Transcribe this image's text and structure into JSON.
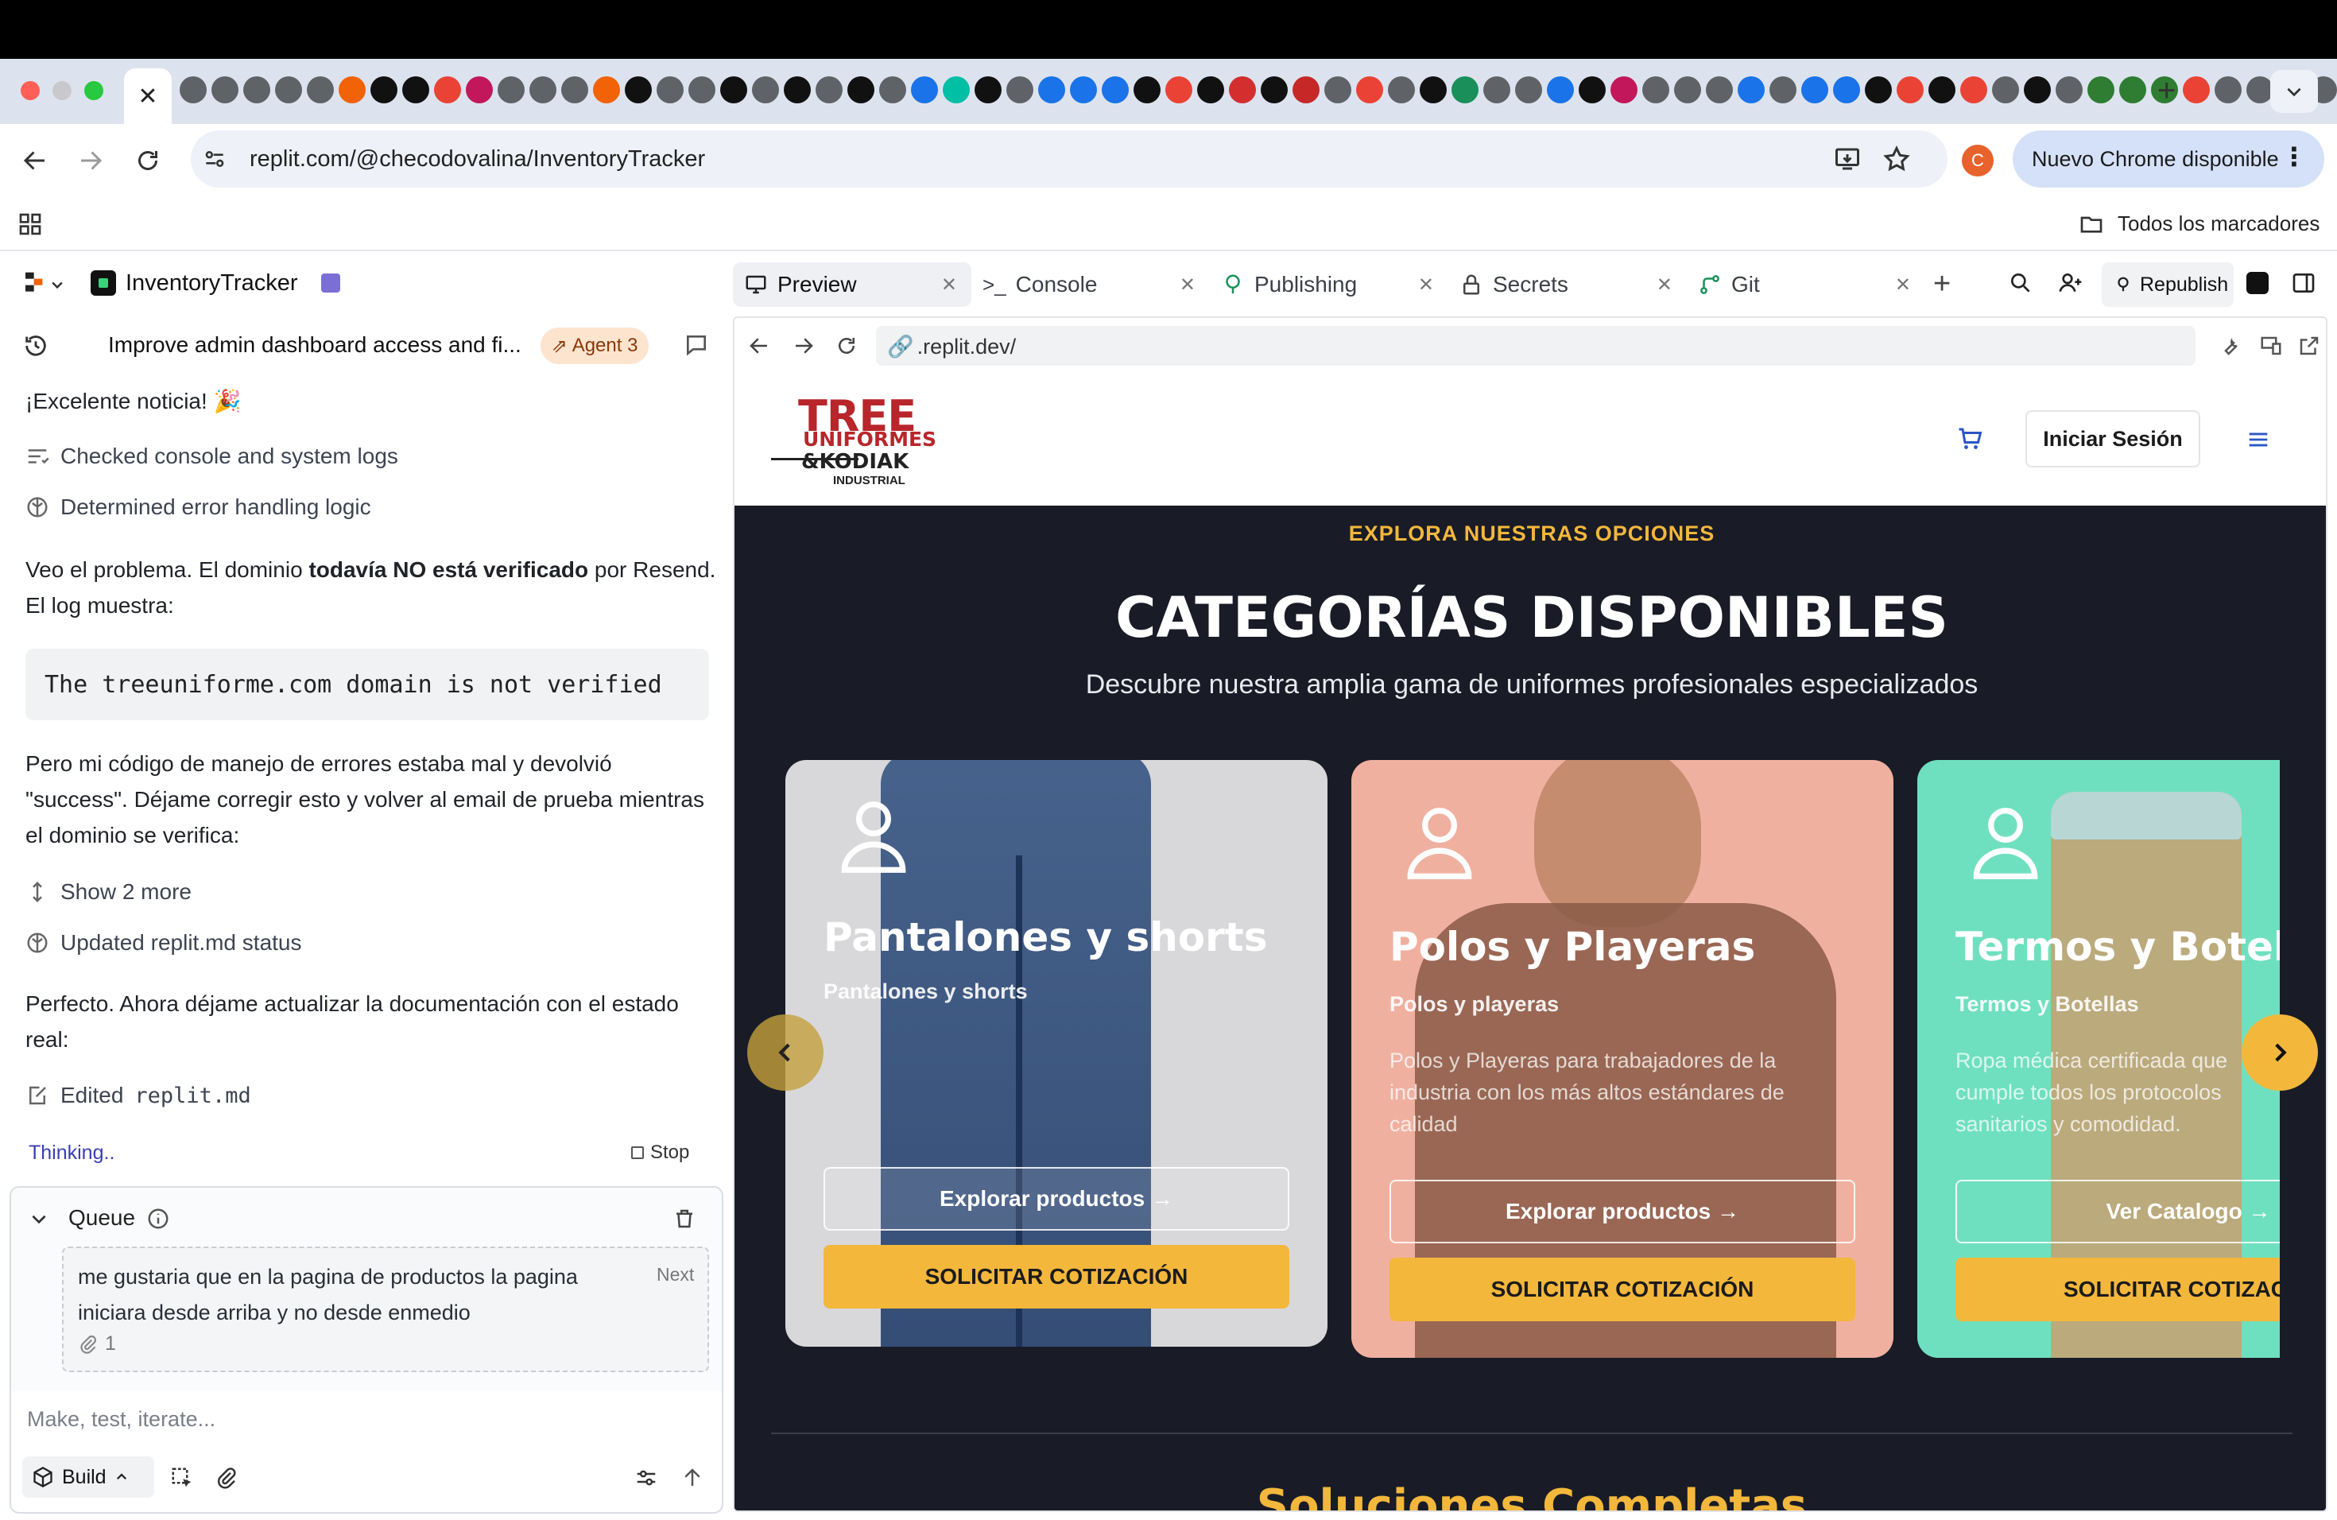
{
  "browser": {
    "url": "replit.com/@checodovalina/InventoryTracker",
    "new_chrome_label": "Nuevo Chrome disponible",
    "avatar_letter": "C",
    "bookmarks_label": "Todos los marcadores",
    "close_tab_glyph": "✕",
    "new_tab_glyph": "+"
  },
  "replit": {
    "project_name": "InventoryTracker",
    "tabs": [
      {
        "label": "Preview",
        "icon": "monitor-icon"
      },
      {
        "label": "Console",
        "icon": "terminal-icon"
      },
      {
        "label": "Publishing",
        "icon": "publish-icon"
      },
      {
        "label": "Secrets",
        "icon": "lock-icon"
      },
      {
        "label": "Git",
        "icon": "git-icon"
      }
    ],
    "republish_label": "Republish"
  },
  "agent": {
    "thread_title": "Improve admin dashboard access and fi...",
    "agent_badge": "Agent 3",
    "messages": {
      "excellent": "¡Excelente noticia! 🎉",
      "step_checked": "Checked console and system logs",
      "step_determined": "Determined error handling logic",
      "problem_pre": "Veo el problema. El dominio ",
      "problem_bold": "todavía NO está verificado",
      "problem_post": " por Resend.",
      "problem_line2": "El log muestra:",
      "code": "The treeuniforme.com domain is not verified",
      "para2_l1": "Pero mi código de manejo de errores estaba mal y devolvió",
      "para2_l2": "\"success\". Déjame corregir esto y volver al email de prueba mientras",
      "para2_l3": "el dominio se verifica:",
      "show_more": "Show 2 more",
      "step_updated": "Updated replit.md status",
      "para3_l1": "Perfecto. Ahora déjame actualizar la documentación con el estado",
      "para3_l2": "real:",
      "edited_label": "Edited",
      "edited_file": "replit.md",
      "thinking": "Thinking..",
      "stop_label": "Stop"
    },
    "queue": {
      "label": "Queue",
      "item_line1": "me gustaria que en la pagina de productos la pagina",
      "item_line2": "iniciara desde arriba y no desde enmedio",
      "item_tag": "Next",
      "attachments": "1"
    },
    "input": {
      "placeholder": "Make, test, iterate...",
      "mode": "Build"
    }
  },
  "preview": {
    "address": ".replit.dev/",
    "site": {
      "logo_line1": "TREE",
      "logo_line2": "UNIFORMES",
      "logo_line3": "&KODIAK",
      "logo_line4": "INDUSTRIAL",
      "login_button": "Iniciar Sesión",
      "eyebrow": "EXPLORA NUESTRAS OPCIONES",
      "heading": "CATEGORÍAS DISPONIBLES",
      "subheading": "Descubre nuestra amplia gama de uniformes profesionales especializados",
      "next_section_heading": "Soluciones Completas",
      "cards": [
        {
          "title": "Pantalones y shorts",
          "subtitle": "Pantalones y shorts",
          "description": "",
          "explore": "Explorar productos →",
          "quote": "SOLICITAR COTIZACIÓN"
        },
        {
          "title": "Polos y Playeras",
          "subtitle": "Polos y playeras",
          "description": "Polos y Playeras para trabajadores de la industria con los más altos estándares de calidad",
          "explore": "Explorar productos →",
          "quote": "SOLICITAR COTIZACIÓN"
        },
        {
          "title": "Termos y Botellas",
          "subtitle": "Termos y Botellas",
          "description": "Ropa médica certificada que cumple todos los protocolos sanitarios y comodidad.",
          "explore": "Ver Catalogo →",
          "quote": "SOLICITAR COTIZACIÓN"
        }
      ]
    }
  },
  "colors": {
    "accent_yellow": "#f3b73c",
    "brand_red": "#b8262b",
    "dark_bg": "#191c26",
    "card1_bg": "#d8d8da",
    "card2_bg": "#f0b0a0",
    "card3_bg": "#6fe0bf"
  }
}
